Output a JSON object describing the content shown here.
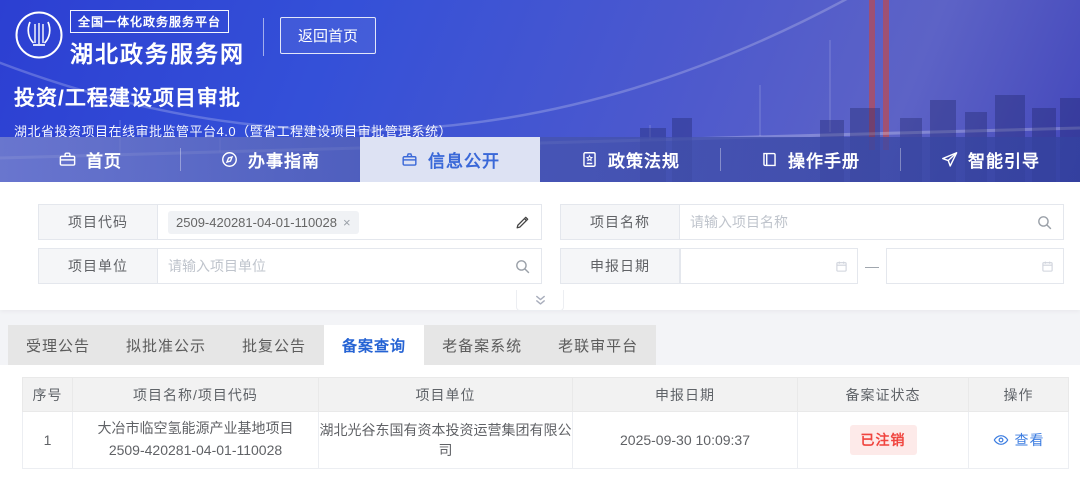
{
  "header": {
    "platform_badge": "全国一体化政务服务平台",
    "site_name": "湖北政务服务网",
    "back_home_label": "返回首页",
    "page_title": "投资/工程建设项目审批",
    "page_subtitle": "湖北省投资项目在线审批监管平台4.0（暨省工程建设项目审批管理系统）"
  },
  "nav": {
    "items": [
      {
        "label": "首页",
        "icon": "home-icon",
        "active": false
      },
      {
        "label": "办事指南",
        "icon": "guide-icon",
        "active": false
      },
      {
        "label": "信息公开",
        "icon": "info-disclosure-icon",
        "active": true
      },
      {
        "label": "政策法规",
        "icon": "policy-icon",
        "active": false
      },
      {
        "label": "操作手册",
        "icon": "manual-icon",
        "active": false
      },
      {
        "label": "智能引导",
        "icon": "smart-guide-icon",
        "active": false
      }
    ]
  },
  "search_form": {
    "project_code": {
      "label": "项目代码",
      "tag_value": "2509-420281-04-01-110028",
      "tag_remove": "×"
    },
    "project_name": {
      "label": "项目名称",
      "placeholder": "请输入项目名称"
    },
    "project_unit": {
      "label": "项目单位",
      "placeholder": "请输入项目单位"
    },
    "declare_date": {
      "label": "申报日期",
      "range_separator": "—"
    }
  },
  "tabs": [
    {
      "label": "受理公告",
      "active": false
    },
    {
      "label": "拟批准公示",
      "active": false
    },
    {
      "label": "批复公告",
      "active": false
    },
    {
      "label": "备案查询",
      "active": true
    },
    {
      "label": "老备案系统",
      "active": false
    },
    {
      "label": "老联审平台",
      "active": false
    }
  ],
  "table": {
    "columns": [
      "序号",
      "项目名称/项目代码",
      "项目单位",
      "申报日期",
      "备案证状态",
      "操作"
    ],
    "rows": [
      {
        "index": "1",
        "project_name": "大冶市临空氢能源产业基地项目",
        "project_code": "2509-420281-04-01-110028",
        "project_unit": "湖北光谷东国有资本投资运营集团有限公司",
        "declare_date": "2025-09-30 10:09:37",
        "status": "已注销",
        "action": "查看"
      }
    ]
  },
  "colors": {
    "accent_blue": "#2563d4",
    "nav_active_bg": "#dde2f3",
    "status_red": "#f0453f",
    "status_red_bg": "#fdeae9",
    "link_blue": "#3b7ce0"
  }
}
